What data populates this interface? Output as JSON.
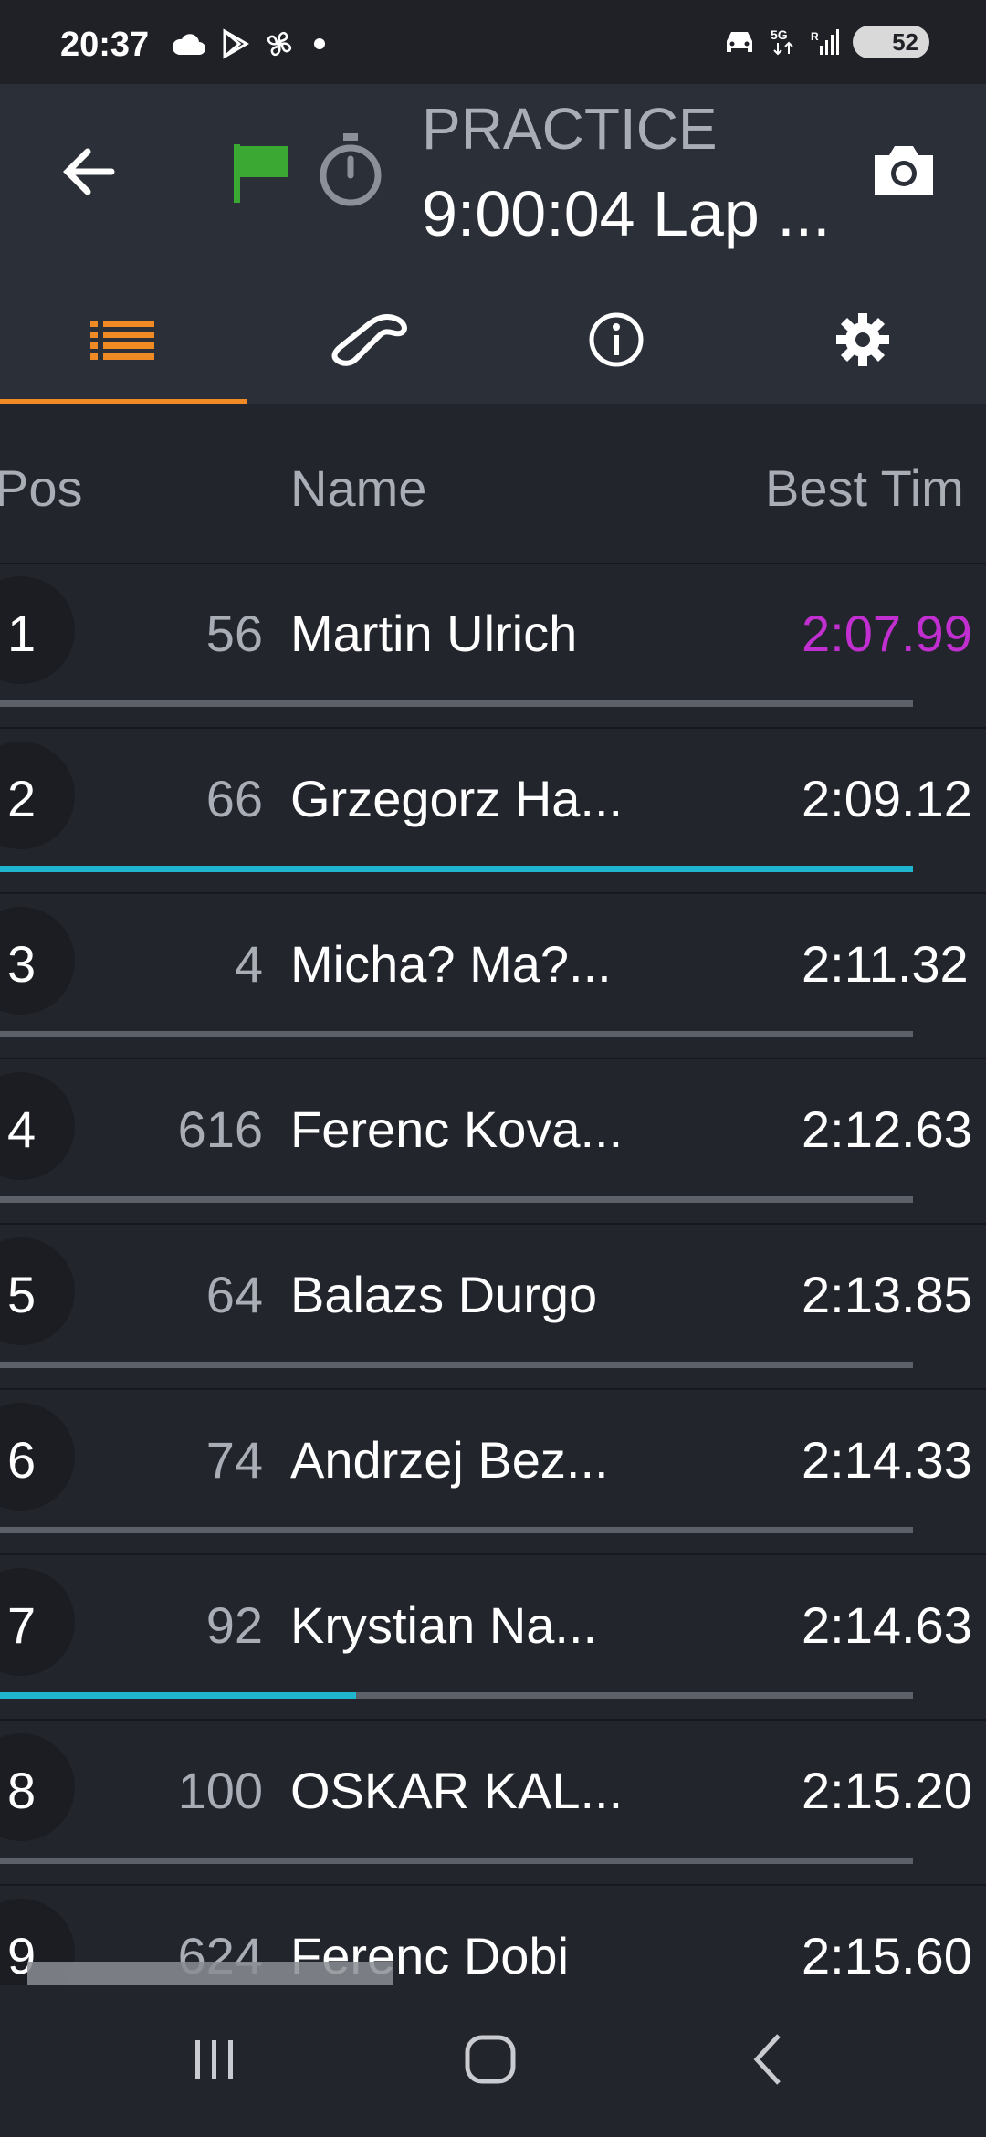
{
  "status_bar": {
    "time": "20:37",
    "battery": "52",
    "left_icons": [
      "cloud-icon",
      "play-store-icon",
      "fan-icon",
      "dot-icon"
    ],
    "right_icons": [
      "car-icon",
      "5g-icon",
      "signal-icon",
      "battery-icon"
    ]
  },
  "header": {
    "session_label": "PRACTICE",
    "session_time": "9:00:04  Lap ...",
    "flag_color": "#3aa832",
    "accent_color": "#f08a24"
  },
  "tabs": [
    {
      "icon": "list-icon",
      "active": true
    },
    {
      "icon": "track-map-icon",
      "active": false
    },
    {
      "icon": "info-icon",
      "active": false
    },
    {
      "icon": "settings-gear-icon",
      "active": false
    }
  ],
  "columns": {
    "pos": "Pos",
    "name": "Name",
    "best": "Best Tim"
  },
  "rows": [
    {
      "pos": "1",
      "number": "56",
      "name": "Martin Ulrich",
      "best": "2:07.99",
      "personal_best": true,
      "progress": 0
    },
    {
      "pos": "2",
      "number": "66",
      "name": "Grzegorz Ha...",
      "best": "2:09.12",
      "personal_best": false,
      "progress": 1.0
    },
    {
      "pos": "3",
      "number": "4",
      "name": "Micha? Ma?...",
      "best": "2:11.32",
      "personal_best": false,
      "progress": 0
    },
    {
      "pos": "4",
      "number": "616",
      "name": "Ferenc Kova...",
      "best": "2:12.63",
      "personal_best": false,
      "progress": 0
    },
    {
      "pos": "5",
      "number": "64",
      "name": "Balazs Durgo",
      "best": "2:13.85",
      "personal_best": false,
      "progress": 0
    },
    {
      "pos": "6",
      "number": "74",
      "name": "Andrzej Bez...",
      "best": "2:14.33",
      "personal_best": false,
      "progress": 0
    },
    {
      "pos": "7",
      "number": "92",
      "name": "Krystian Na...",
      "best": "2:14.63",
      "personal_best": false,
      "progress": 0.39
    },
    {
      "pos": "8",
      "number": "100",
      "name": "OSKAR KAL...",
      "best": "2:15.20",
      "personal_best": false,
      "progress": 0
    },
    {
      "pos": "9",
      "number": "624",
      "name": "Ferenc Dobi",
      "best": "2:15.60",
      "personal_best": false,
      "progress": 0
    }
  ],
  "nav": [
    "recent-apps-icon",
    "home-icon",
    "back-icon"
  ]
}
